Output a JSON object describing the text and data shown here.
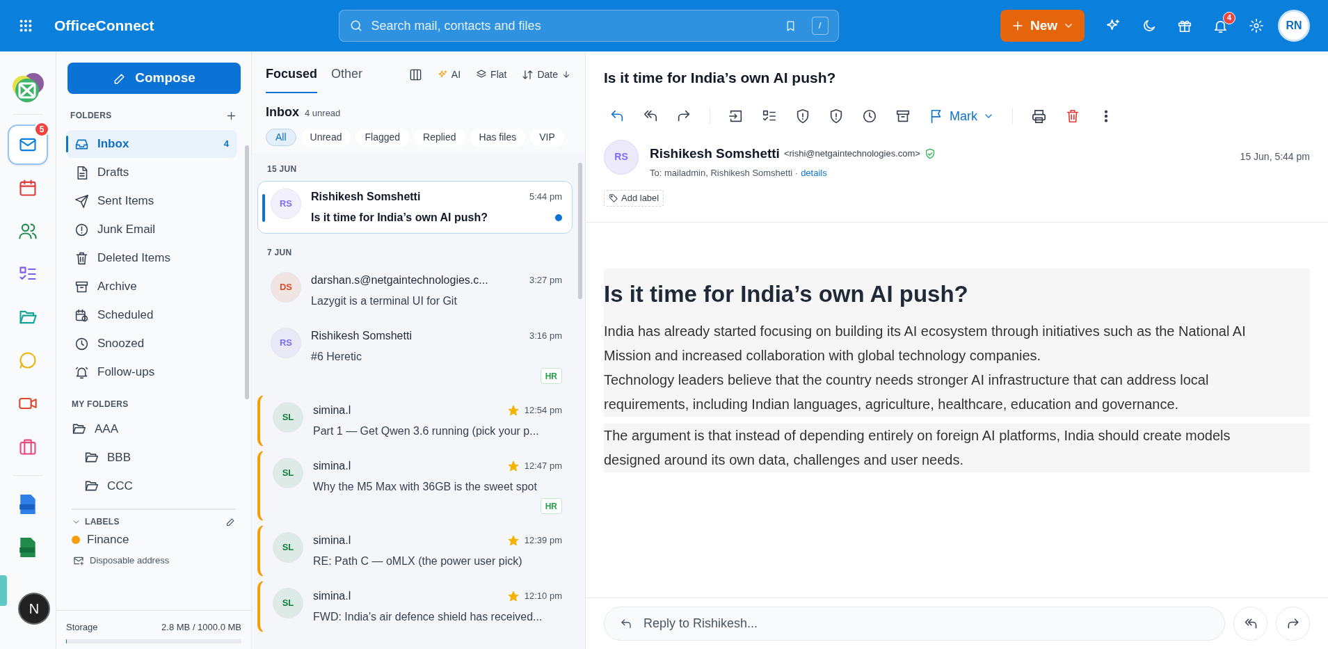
{
  "app": {
    "name": "OfficeConnect"
  },
  "search": {
    "placeholder": "Search mail, contacts and files",
    "shortcut": "/"
  },
  "new_button": {
    "label": "New"
  },
  "notifications": {
    "count": "4"
  },
  "user": {
    "initials": "RN"
  },
  "rail": {
    "items": [
      {
        "selected": true,
        "badge": "5"
      },
      {
        "selected": false
      },
      {
        "selected": false
      },
      {
        "selected": false
      },
      {
        "selected": false
      },
      {
        "selected": false
      },
      {
        "selected": false
      },
      {
        "selected": false
      }
    ],
    "user_initial": "N"
  },
  "compose": {
    "label": "Compose"
  },
  "folders": {
    "heading": "FOLDERS",
    "items": [
      {
        "label": "Inbox",
        "count": "4",
        "selected": true
      },
      {
        "label": "Drafts",
        "selected": false
      },
      {
        "label": "Sent Items",
        "selected": false
      },
      {
        "label": "Junk Email",
        "selected": false
      },
      {
        "label": "Deleted Items",
        "selected": false
      },
      {
        "label": "Archive",
        "selected": false
      },
      {
        "label": "Scheduled",
        "selected": false
      },
      {
        "label": "Snoozed",
        "selected": false
      },
      {
        "label": "Follow-ups",
        "selected": false
      }
    ]
  },
  "my_folders": {
    "heading": "MY FOLDERS",
    "items": [
      {
        "label": "AAA",
        "children": [
          {
            "label": "BBB"
          },
          {
            "label": "CCC"
          }
        ]
      }
    ]
  },
  "labels": {
    "heading": "LABELS",
    "expanded": true,
    "items": [
      {
        "label": "Finance",
        "color": "#f59e0b"
      }
    ],
    "disposable": "Disposable address"
  },
  "storage": {
    "label": "Storage",
    "reading": "2.8 MB / 1000.0 MB",
    "level": 0.003
  },
  "list": {
    "tabs": [
      {
        "label": "Focused",
        "selected": true
      },
      {
        "label": "Other",
        "selected": false
      }
    ],
    "tools": {
      "ai": "AI",
      "flat": "Flat",
      "sort": "Date"
    },
    "title": "Inbox",
    "unread": "4 unread",
    "filters": [
      {
        "label": "All",
        "selected": true
      },
      {
        "label": "Unread",
        "selected": false
      },
      {
        "label": "Flagged",
        "selected": false
      },
      {
        "label": "Replied",
        "selected": false
      },
      {
        "label": "Has files",
        "selected": false
      },
      {
        "label": "VIP",
        "selected": false
      }
    ],
    "groups": [
      {
        "date": "15 JUN",
        "messages": [
          {
            "initials": "RS",
            "color": "#7c6cf0",
            "sender": "Rishikesh Somshetti",
            "time": "5:44 pm",
            "subject": "Is it time for India’s own AI push?",
            "unread": true,
            "selected": true,
            "starred": false,
            "flagged": false
          }
        ]
      },
      {
        "date": "7 JUN",
        "messages": [
          {
            "initials": "DS",
            "color": "#dc4a26",
            "sender": "darshan.s@netgaintechnologies.c...",
            "time": "3:27 pm",
            "subject": "Lazygit is a terminal UI for Git",
            "unread": false,
            "selected": false,
            "starred": false,
            "flagged": false
          },
          {
            "initials": "RS",
            "color": "#7c6cf0",
            "sender": "Rishikesh Somshetti",
            "time": "3:16 pm",
            "subject": "#6 Heretic",
            "tag": "HR",
            "unread": false,
            "selected": false,
            "starred": false,
            "flagged": false
          },
          {
            "initials": "SL",
            "color": "#15803d",
            "sender": "simina.l",
            "time": "12:54 pm",
            "subject": "Part 1 — Get Qwen 3.6 running (pick your p...",
            "unread": false,
            "selected": false,
            "starred": true,
            "flagged": true
          },
          {
            "initials": "SL",
            "color": "#15803d",
            "sender": "simina.l",
            "time": "12:47 pm",
            "subject": "Why the M5 Max with 36GB is the sweet spot",
            "tag": "HR",
            "unread": false,
            "selected": false,
            "starred": true,
            "flagged": true
          },
          {
            "initials": "SL",
            "color": "#15803d",
            "sender": "simina.l",
            "time": "12:39 pm",
            "subject": "RE: Path C — oMLX (the power user pick)",
            "unread": false,
            "selected": false,
            "starred": true,
            "flagged": true
          },
          {
            "initials": "SL",
            "color": "#15803d",
            "sender": "simina.l",
            "time": "12:10 pm",
            "subject": "FWD: India's air defence shield has received...",
            "unread": false,
            "selected": false,
            "starred": true,
            "flagged": true
          }
        ]
      }
    ]
  },
  "message": {
    "subject": "Is it time for India’s own AI push?",
    "mark": "Mark",
    "sender": {
      "initials": "RS",
      "name": "Rishikesh Somshetti",
      "email": "<rishi@netgaintechnologies.com>",
      "verified": true
    },
    "to": "To: mailadmin, Rishikesh Somshetti ·",
    "details": "details",
    "date": "15 Jun, 5:44 pm",
    "add_label": "Add label",
    "body": [
      {
        "kind": "heading",
        "text": "Is it time for India’s own AI push?"
      },
      {
        "kind": "paragraph",
        "text": "India has already started focusing on building its AI ecosystem through initiatives such as the National AI Mission and increased collaboration with global technology companies."
      },
      {
        "kind": "paragraph",
        "text": "Technology leaders believe that the country needs stronger AI infrastructure that can address local requirements, including Indian languages, agriculture, healthcare, education and governance."
      },
      {
        "kind": "gap"
      },
      {
        "kind": "paragraph",
        "text": "The argument is that instead of depending entirely on foreign AI platforms, India should create models designed around its own data, challenges and user needs."
      }
    ],
    "reply_placeholder": "Reply to Rishikesh..."
  }
}
